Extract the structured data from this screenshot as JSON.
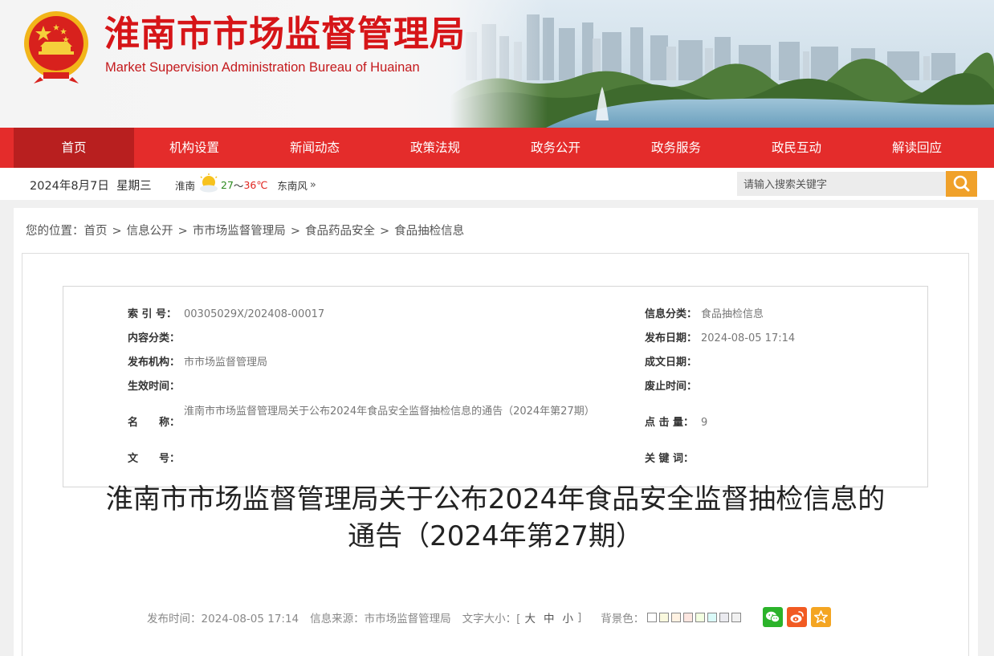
{
  "header": {
    "title_cn": "淮南市市场监督管理局",
    "title_en": "Market Supervision Administration Bureau of Huainan",
    "emblem_icon": "national-emblem-icon",
    "banner_icon": "city-skyline-icon"
  },
  "nav": {
    "items": [
      "首页",
      "机构设置",
      "新闻动态",
      "政策法规",
      "政务公开",
      "政务服务",
      "政民互动",
      "解读回应"
    ],
    "active_index": 0
  },
  "infobar": {
    "date": "2024年8月7日",
    "weekday": "星期三",
    "city": "淮南",
    "temp_low": "27",
    "temp_sep": "～",
    "temp_high": "36℃",
    "wind": "东南风",
    "more": "»",
    "search_placeholder": "请输入搜索关键字"
  },
  "breadcrumb": {
    "prefix": "您的位置：",
    "items": [
      "首页",
      "信息公开",
      "市市场监督管理局",
      "食品药品安全",
      "食品抽检信息"
    ],
    "separator": ">"
  },
  "meta": {
    "index_label": "索 引 号：",
    "index_value": "00305029X/202408-00017",
    "category_label": "信息分类：",
    "category_value": "食品抽检信息",
    "content_label": "内容分类：",
    "content_value": "",
    "pubdate_label": "发布日期：",
    "pubdate_value": "2024-08-05 17:14",
    "org_label": "发布机构：",
    "org_value": "市市场监督管理局",
    "written_label": "成文日期：",
    "written_value": "",
    "effective_label": "生效时间：",
    "effective_value": "",
    "expire_label": "废止时间：",
    "expire_value": "",
    "name_label": "名　　称：",
    "name_value": "淮南市市场监督管理局关于公布2024年食品安全监督抽检信息的通告（2024年第27期）",
    "clicks_label": "点 击 量：",
    "clicks_value": "9",
    "docno_label": "文　　号：",
    "docno_value": "",
    "keywords_label": "关 键 词：",
    "keywords_value": ""
  },
  "article": {
    "title_line1": "淮南市市场监督管理局关于公布2024年食品安全监督抽检信息的",
    "title_line2": "通告（2024年第27期）"
  },
  "pubbar": {
    "pub_time": "发布时间：2024-08-05 17:14",
    "source": "信息来源：市市场监督管理局",
    "font_label": "文字大小：[",
    "font_large": "大",
    "font_mid": "中",
    "font_small": "小",
    "font_close": "]",
    "bg_label": "背景色：",
    "bg_colors": [
      "#ffffff",
      "#faf9de",
      "#fff2e2",
      "#fde6e0",
      "#f3ffe1",
      "#dafaf8",
      "#eaeaef",
      "#f1f1f1"
    ],
    "share_wechat": "wechat-icon",
    "share_weibo": "weibo-icon",
    "share_fav": "star-icon"
  },
  "colors": {
    "brand_red": "#e42c2b",
    "nav_active": "#b81f1f",
    "search_orange": "#f0a12a"
  }
}
